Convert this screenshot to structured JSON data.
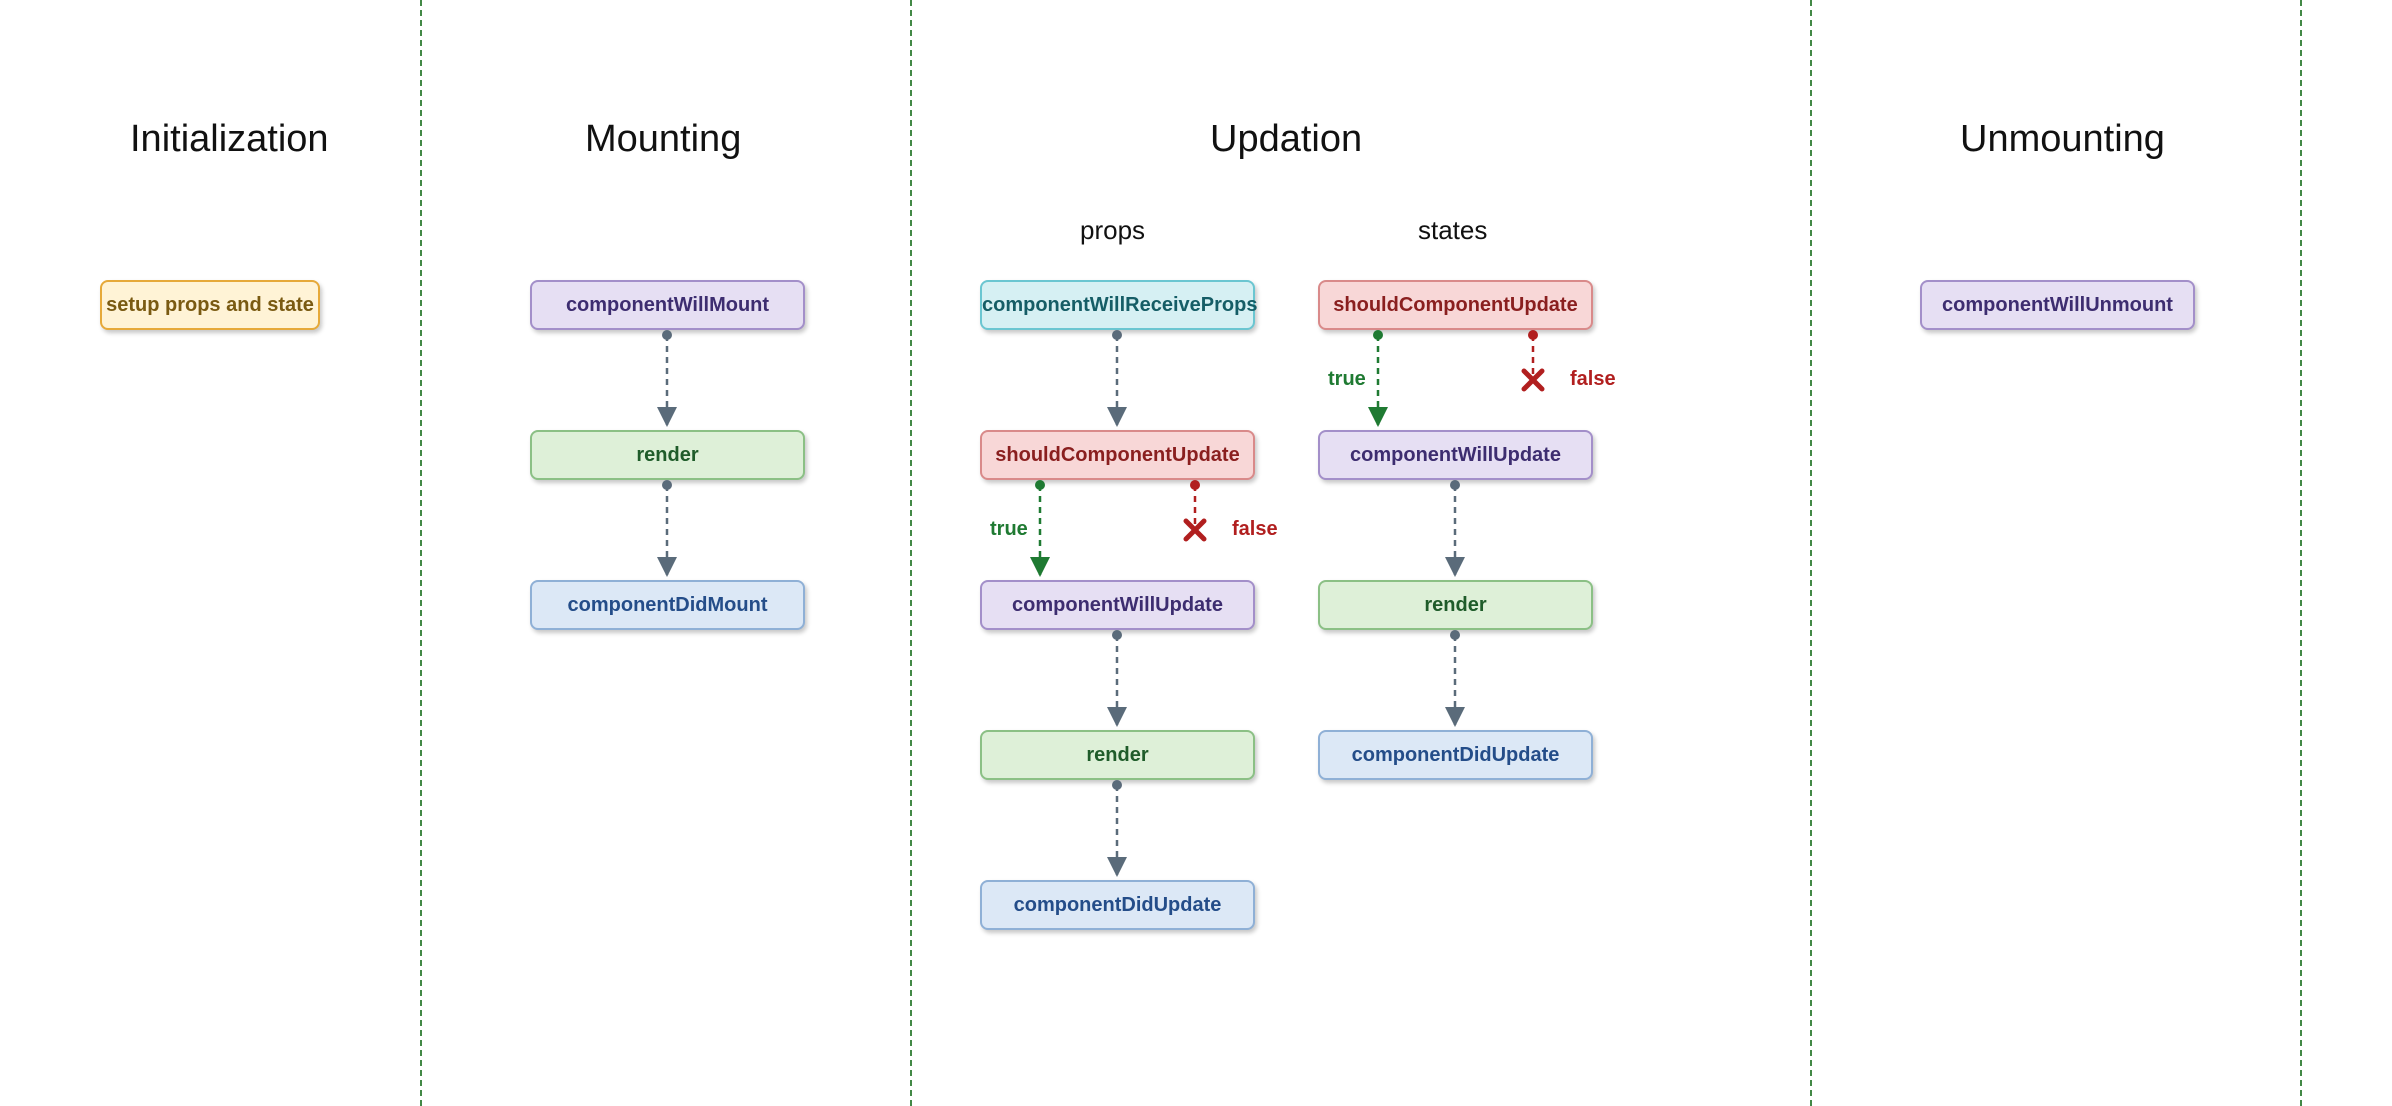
{
  "columns": {
    "initialization": {
      "title": "Initialization"
    },
    "mounting": {
      "title": "Mounting"
    },
    "updation": {
      "title": "Updation",
      "sub_props": "props",
      "sub_states": "states"
    },
    "unmounting": {
      "title": "Unmounting"
    }
  },
  "nodes": {
    "init_setup": "setup props and state",
    "mount_will": "componentWillMount",
    "mount_render": "render",
    "mount_did": "componentDidMount",
    "props_willReceive": "componentWillReceiveProps",
    "props_should": "shouldComponentUpdate",
    "props_willUpdate": "componentWillUpdate",
    "props_render": "render",
    "props_didUpdate": "componentDidUpdate",
    "states_should": "shouldComponentUpdate",
    "states_willUpdate": "componentWillUpdate",
    "states_render": "render",
    "states_didUpdate": "componentDidUpdate",
    "unmount_will": "componentWillUnmount"
  },
  "labels": {
    "true": "true",
    "false": "false"
  },
  "colors": {
    "yellow": "#fff3d6",
    "purple": "#e6dff3",
    "green": "#def0d8",
    "blue": "#dce8f6",
    "cyan": "#d6f0f3",
    "red": "#f8d7d7",
    "edge_gray": "#5a6b7a",
    "edge_green": "#1f7a32",
    "edge_red": "#b11f1f",
    "divider": "#2e7d32"
  }
}
